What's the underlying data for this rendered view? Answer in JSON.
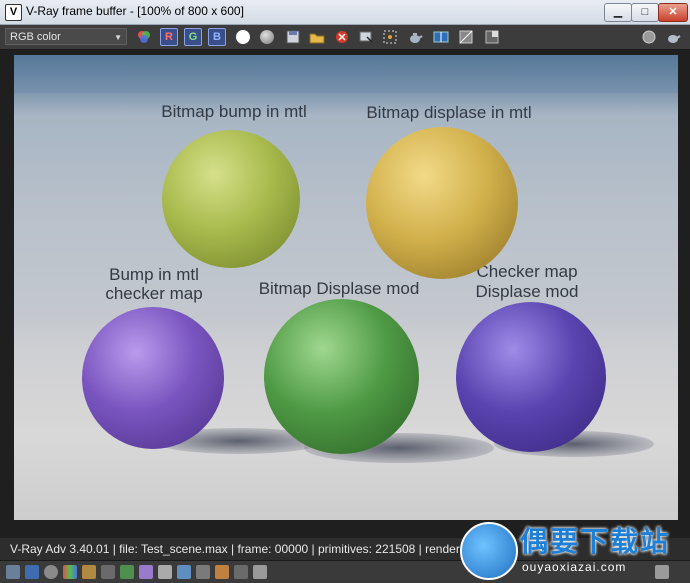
{
  "window": {
    "title": "V-Ray frame buffer - [100% of 800 x 600]",
    "app_icon_glyph": "V",
    "min_glyph": "▁",
    "max_glyph": "□",
    "close_glyph": "✕"
  },
  "toolbar": {
    "channel_select": "RGB color",
    "channel_r": "R",
    "channel_g": "G",
    "channel_b": "B",
    "icons": [
      "colors-icon",
      "red-channel",
      "green-channel",
      "blue-channel",
      "white-dot-icon",
      "gray-dot-icon",
      "save-icon",
      "open-icon",
      "clear-icon",
      "track-icon",
      "region-icon",
      "teapot-icon",
      "compare-icon",
      "lut-icon",
      "pixel-icon",
      "sphere-icon",
      "teapot-right-icon"
    ]
  },
  "render": {
    "labels": {
      "bitmap_bump": "Bitmap bump in mtl",
      "bitmap_displace": "Bitmap displase in mtl",
      "bump_checker_line1": "Bump in mtl",
      "bump_checker_line2": "checker map",
      "bitmap_displace_mod": "Bitmap Displase mod",
      "checker_line1": "Checker map",
      "checker_line2": "Displase mod"
    },
    "colors": {
      "sphere_yellow_green": "#a8ba4c",
      "sphere_yellow": "#d2b14c",
      "sphere_purple": "#7a55c0",
      "sphere_green": "#4f9a45",
      "sphere_blue_purple": "#5a44b0"
    }
  },
  "status": {
    "text": "V-Ray Adv 3.40.01 | file: Test_scene.max | frame: 00000 | primitives: 221508 | render time: 0h"
  },
  "watermark": {
    "text": "偶要下载站",
    "url": "ouyaoxiazai.com"
  }
}
